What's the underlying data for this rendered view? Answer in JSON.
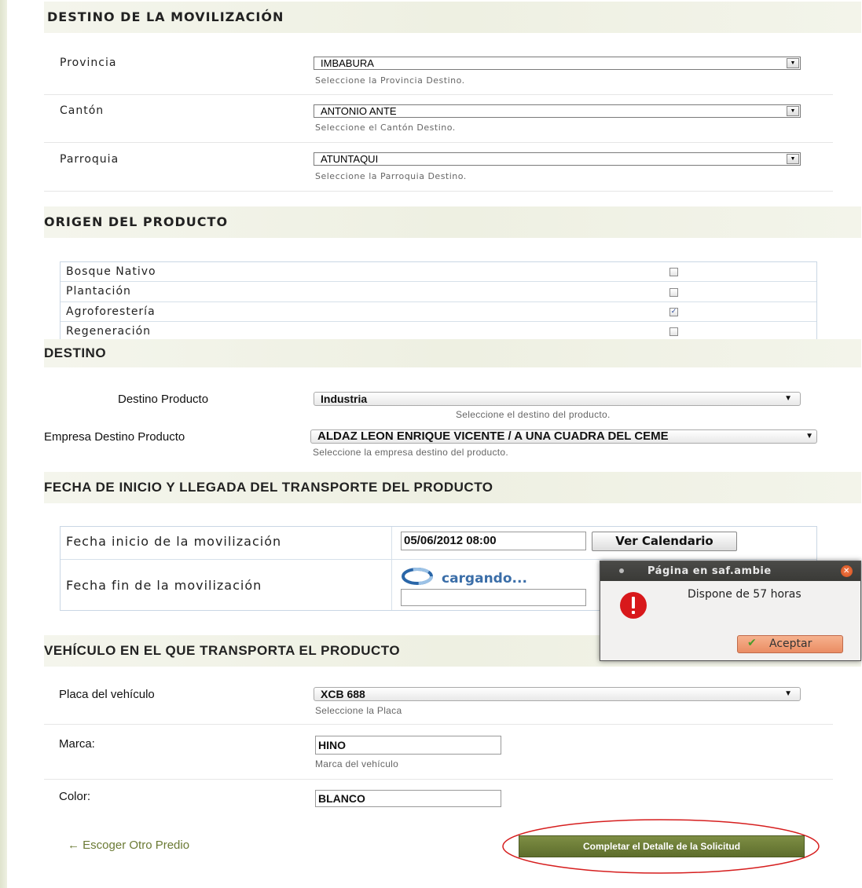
{
  "destino_movilizacion": {
    "header": "DESTINO DE LA MOVILIZACIÓN",
    "provincia": {
      "label": "Provincia",
      "value": "IMBABURA",
      "hint": "Seleccione la Provincia Destino."
    },
    "canton": {
      "label": "Cantón",
      "value": "ANTONIO ANTE",
      "hint": "Seleccione el Cantón Destino."
    },
    "parroquia": {
      "label": "Parroquia",
      "value": "ATUNTAQUI",
      "hint": "Seleccione la Parroquia Destino."
    }
  },
  "origen": {
    "header": "ORIGEN DEL PRODUCTO",
    "items": [
      {
        "label": "Bosque Nativo",
        "checked": false
      },
      {
        "label": "Plantación",
        "checked": false
      },
      {
        "label": "Agroforestería",
        "checked": true
      },
      {
        "label": "Regeneración",
        "checked": false
      }
    ]
  },
  "destino": {
    "header": "DESTINO",
    "producto": {
      "label": "Destino Producto",
      "value": "Industria",
      "hint": "Seleccione el destino del producto."
    },
    "empresa": {
      "label": "Empresa Destino Producto",
      "value": "ALDAZ LEON ENRIQUE VICENTE / A UNA CUADRA DEL CEME",
      "hint": "Seleccione la empresa destino del producto."
    }
  },
  "fechas": {
    "header": "FECHA DE INICIO Y LLEGADA DEL TRANSPORTE DEL PRODUCTO",
    "inicio_label": "Fecha inicio de la movilización",
    "inicio_value": "05/06/2012 08:00",
    "calendar_button": "Ver Calendario",
    "fin_label": "Fecha fin de la movilización",
    "loading_text": "cargando..."
  },
  "vehiculo": {
    "header": "VEHÍCULO EN EL QUE TRANSPORTA EL PRODUCTO",
    "placa": {
      "label": "Placa del vehículo",
      "value": "XCB 688",
      "hint": "Seleccione la Placa"
    },
    "marca": {
      "label": "Marca:",
      "value": "HINO",
      "hint": "Marca del vehículo"
    },
    "color": {
      "label": "Color:",
      "value": "BLANCO"
    }
  },
  "actions": {
    "back_link": "← Escoger Otro Predio",
    "submit": "Completar el Detalle de la Solicitud"
  },
  "dialog": {
    "title": "Página en saf.ambie",
    "message": "Dispone de 57 horas",
    "ok": "Aceptar"
  },
  "colors": {
    "accent": "#6b7a34",
    "dialog_title": "#3c3b37",
    "error_red": "#d8181b",
    "ok_button": "#f0a080"
  }
}
